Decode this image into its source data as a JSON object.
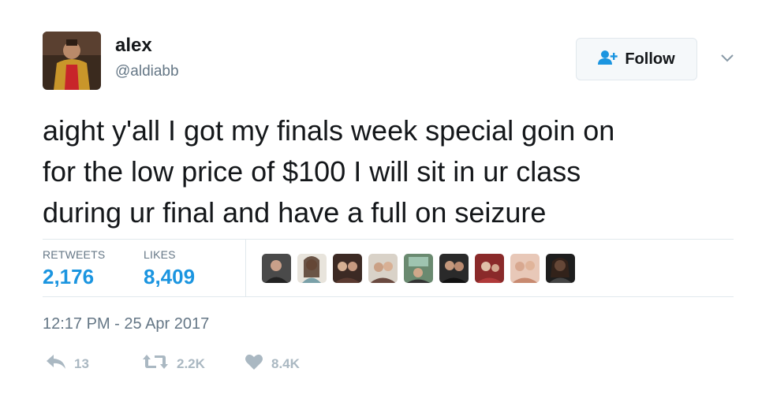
{
  "user": {
    "name": "alex",
    "handle": "@aldiabb"
  },
  "follow_button": {
    "label": "Follow",
    "icon": "add-user-icon"
  },
  "tweet": {
    "text_lines": [
      "aight y'all I got my finals week special goin on",
      "for the low price of $100 I will sit in ur class",
      "during ur final and have a full on seizure"
    ],
    "timestamp": "12:17 PM - 25 Apr 2017"
  },
  "stats": {
    "retweets_label": "RETWEETS",
    "retweets_value": "2,176",
    "likes_label": "LIKES",
    "likes_value": "8,409"
  },
  "likers_count_shown": 9,
  "actions": {
    "reply_count": "13",
    "retweet_count": "2.2K",
    "like_count": "8.4K"
  },
  "colors": {
    "accent": "#1b95e0",
    "muted": "#657786",
    "icon_muted": "#aab8c2",
    "divider": "#e1e8ed"
  }
}
